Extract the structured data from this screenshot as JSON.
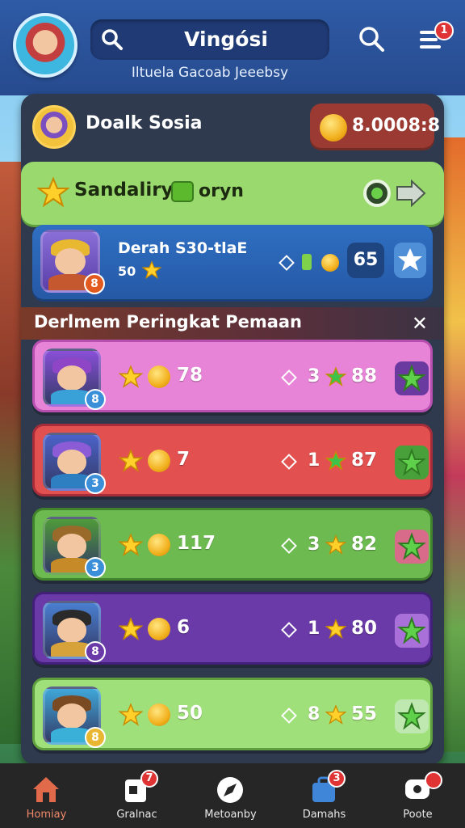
{
  "colors": {
    "accent": "#2e5aa6",
    "panel": "#2f3a4e",
    "nav_active": "#f08a6a",
    "badge": "#e03434"
  },
  "header": {
    "title": "Vingósi",
    "subtitle": "Iltuela Gacoab Jeeebsy",
    "menu_badge": "1",
    "icons": [
      "avatar",
      "search-icon",
      "search-icon",
      "menu-icon"
    ]
  },
  "profile": {
    "name": "Doalk Sosia",
    "coins": "8.0008:8"
  },
  "banner": {
    "label": "Sandaliry",
    "label2": "oryn"
  },
  "hero": {
    "name": "Derah S30-tlaE",
    "sub": "50",
    "level": "8",
    "stat": "65"
  },
  "leaderboard": {
    "title": "Derlmem Peringkat Pemaan",
    "close_label": "✕",
    "rows": [
      {
        "value": "78",
        "rank": "3",
        "score": "88",
        "level": "8",
        "color": "#e884d8",
        "border": "#b74fb0"
      },
      {
        "value": "7",
        "rank": "1",
        "score": "87",
        "level": "3",
        "color": "#e25050",
        "border": "#a82d3a"
      },
      {
        "value": "117",
        "rank": "3",
        "score": "82",
        "level": "3",
        "color": "#6dbb50",
        "border": "#41822c"
      },
      {
        "value": "6",
        "rank": "1",
        "score": "80",
        "level": "8",
        "color": "#6a3aa8",
        "border": "#42207a"
      },
      {
        "value": "50",
        "rank": "8",
        "score": "55",
        "level": "8",
        "color": "#a0e07a",
        "border": "#5f9f3e"
      }
    ]
  },
  "nav": {
    "items": [
      {
        "label": "Homiay",
        "badge": ""
      },
      {
        "label": "Gralnac",
        "badge": "7"
      },
      {
        "label": "Metoanby",
        "badge": ""
      },
      {
        "label": "Damahs",
        "badge": "3"
      },
      {
        "label": "Poote",
        "badge": ""
      }
    ]
  }
}
